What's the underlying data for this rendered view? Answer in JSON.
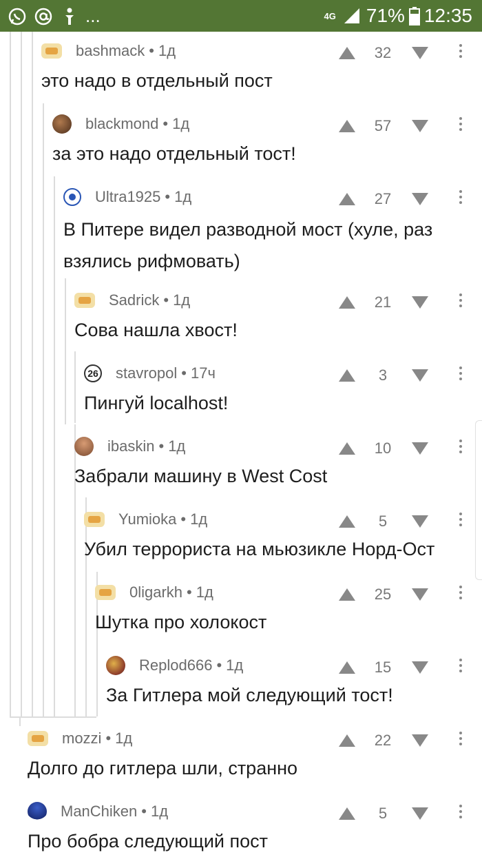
{
  "status_bar": {
    "left_icons": [
      "whatsapp-icon",
      "at-icon",
      "figure-icon"
    ],
    "ellipsis": "...",
    "network": "4G",
    "battery": "71%",
    "time": "12:35",
    "color": "#537634"
  },
  "comments": [
    {
      "author": "bashmack",
      "time": "1д",
      "score": "32",
      "text": "это надо в отдельный пост",
      "avatar": "default"
    },
    {
      "author": "blackmond",
      "time": "1д",
      "score": "57",
      "text": "за это надо отдельный тост!",
      "avatar": "brown"
    },
    {
      "author": "Ultra1925",
      "time": "1д",
      "score": "27",
      "text": "В Питере видел разводной мост (хуле, раз взялись рифмовать)",
      "avatar": "blue"
    },
    {
      "author": "Sadrick",
      "time": "1д",
      "score": "21",
      "text": "Сова нашла хвост!",
      "avatar": "default"
    },
    {
      "author": "stavropol",
      "time": "17ч",
      "score": "3",
      "text": "Пингуй localhost!",
      "avatar": "26",
      "avatar_text": "26"
    },
    {
      "author": "ibaskin",
      "time": "1д",
      "score": "10",
      "text": "Забрали машину в West Cost",
      "avatar": "man"
    },
    {
      "author": "Yumioka",
      "time": "1д",
      "score": "5",
      "text": "Убил террориста на мьюзикле Норд-Ост",
      "avatar": "default"
    },
    {
      "author": "0ligarkh",
      "time": "1д",
      "score": "25",
      "text": "Шутка про холокост",
      "avatar": "default"
    },
    {
      "author": "Replod666",
      "time": "1д",
      "score": "15",
      "text": "За Гитлера мой следующий тост!",
      "avatar": "color"
    },
    {
      "author": "mozzi",
      "time": "1д",
      "score": "22",
      "text": "Долго до гитлера шли, странно",
      "avatar": "default"
    },
    {
      "author": "ManChiken",
      "time": "1д",
      "score": "5",
      "text": "Про бобра следующий пост",
      "avatar": "blueman"
    }
  ]
}
